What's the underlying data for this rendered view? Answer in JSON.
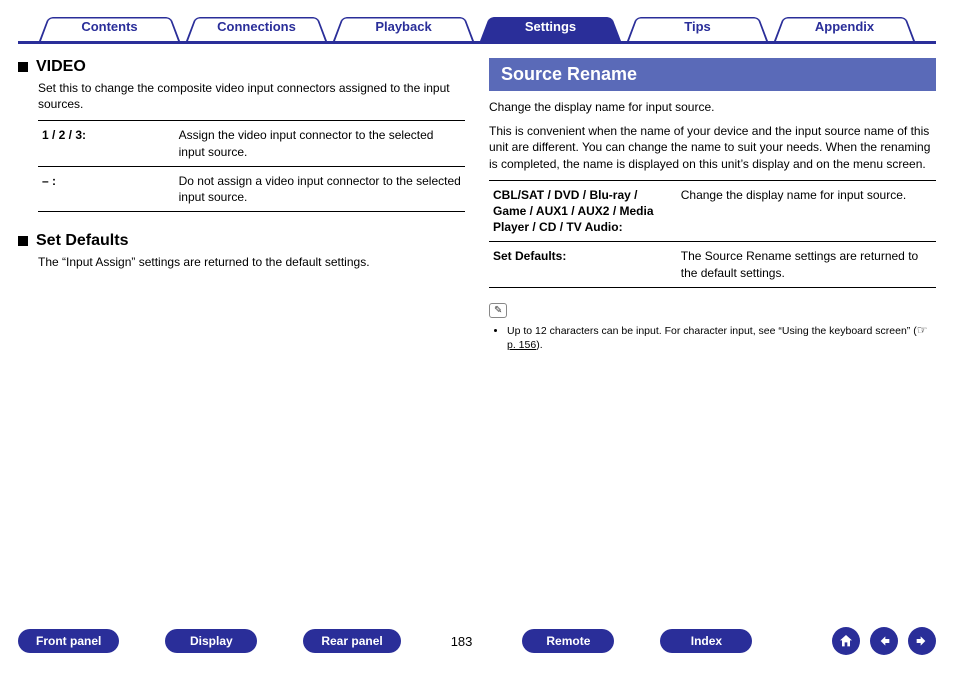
{
  "tabs": {
    "contents": "Contents",
    "connections": "Connections",
    "playback": "Playback",
    "settings": "Settings",
    "tips": "Tips",
    "appendix": "Appendix"
  },
  "left": {
    "video": {
      "title": "VIDEO",
      "desc": "Set this to change the composite video input connectors assigned to the input sources.",
      "rows": [
        {
          "k": "1 / 2 / 3:",
          "v": "Assign the video input connector to the selected input source."
        },
        {
          "k": "– :",
          "v": "Do not assign a video input connector to the selected input source."
        }
      ]
    },
    "defaults": {
      "title": "Set Defaults",
      "desc": "The “Input Assign” settings are returned to the default settings."
    }
  },
  "right": {
    "banner": "Source Rename",
    "p1": "Change the display name for input source.",
    "p2": "This is convenient when the name of your device and the input source name of this unit are different. You can change the name to suit your needs. When the renaming is completed, the name is displayed on this unit’s display and on the menu screen.",
    "rows": [
      {
        "k": "CBL/SAT / DVD / Blu-ray / Game / AUX1 / AUX2 / Media Player / CD / TV Audio:",
        "v": "Change the display name for input source."
      },
      {
        "k": "Set Defaults:",
        "v": "The Source Rename settings are returned to the default settings."
      }
    ],
    "note_prefix": "Up to 12 characters can be input. For character input, see “Using the keyboard screen” (",
    "note_link": " p. 156",
    "note_suffix": ")."
  },
  "footer": {
    "front": "Front panel",
    "display": "Display",
    "rear": "Rear panel",
    "page": "183",
    "remote": "Remote",
    "index": "Index"
  }
}
